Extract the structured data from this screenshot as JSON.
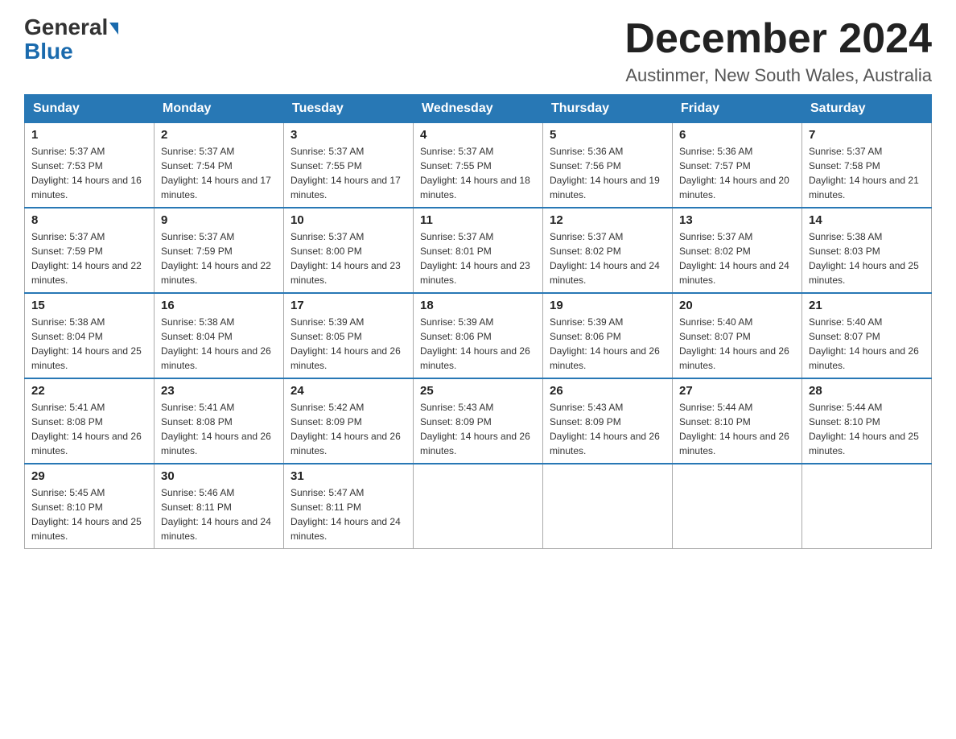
{
  "logo": {
    "general": "General",
    "blue": "Blue"
  },
  "title": {
    "month_year": "December 2024",
    "location": "Austinmer, New South Wales, Australia"
  },
  "headers": [
    "Sunday",
    "Monday",
    "Tuesday",
    "Wednesday",
    "Thursday",
    "Friday",
    "Saturday"
  ],
  "weeks": [
    [
      {
        "day": "1",
        "sunrise": "5:37 AM",
        "sunset": "7:53 PM",
        "daylight": "14 hours and 16 minutes."
      },
      {
        "day": "2",
        "sunrise": "5:37 AM",
        "sunset": "7:54 PM",
        "daylight": "14 hours and 17 minutes."
      },
      {
        "day": "3",
        "sunrise": "5:37 AM",
        "sunset": "7:55 PM",
        "daylight": "14 hours and 17 minutes."
      },
      {
        "day": "4",
        "sunrise": "5:37 AM",
        "sunset": "7:55 PM",
        "daylight": "14 hours and 18 minutes."
      },
      {
        "day": "5",
        "sunrise": "5:36 AM",
        "sunset": "7:56 PM",
        "daylight": "14 hours and 19 minutes."
      },
      {
        "day": "6",
        "sunrise": "5:36 AM",
        "sunset": "7:57 PM",
        "daylight": "14 hours and 20 minutes."
      },
      {
        "day": "7",
        "sunrise": "5:37 AM",
        "sunset": "7:58 PM",
        "daylight": "14 hours and 21 minutes."
      }
    ],
    [
      {
        "day": "8",
        "sunrise": "5:37 AM",
        "sunset": "7:59 PM",
        "daylight": "14 hours and 22 minutes."
      },
      {
        "day": "9",
        "sunrise": "5:37 AM",
        "sunset": "7:59 PM",
        "daylight": "14 hours and 22 minutes."
      },
      {
        "day": "10",
        "sunrise": "5:37 AM",
        "sunset": "8:00 PM",
        "daylight": "14 hours and 23 minutes."
      },
      {
        "day": "11",
        "sunrise": "5:37 AM",
        "sunset": "8:01 PM",
        "daylight": "14 hours and 23 minutes."
      },
      {
        "day": "12",
        "sunrise": "5:37 AM",
        "sunset": "8:02 PM",
        "daylight": "14 hours and 24 minutes."
      },
      {
        "day": "13",
        "sunrise": "5:37 AM",
        "sunset": "8:02 PM",
        "daylight": "14 hours and 24 minutes."
      },
      {
        "day": "14",
        "sunrise": "5:38 AM",
        "sunset": "8:03 PM",
        "daylight": "14 hours and 25 minutes."
      }
    ],
    [
      {
        "day": "15",
        "sunrise": "5:38 AM",
        "sunset": "8:04 PM",
        "daylight": "14 hours and 25 minutes."
      },
      {
        "day": "16",
        "sunrise": "5:38 AM",
        "sunset": "8:04 PM",
        "daylight": "14 hours and 26 minutes."
      },
      {
        "day": "17",
        "sunrise": "5:39 AM",
        "sunset": "8:05 PM",
        "daylight": "14 hours and 26 minutes."
      },
      {
        "day": "18",
        "sunrise": "5:39 AM",
        "sunset": "8:06 PM",
        "daylight": "14 hours and 26 minutes."
      },
      {
        "day": "19",
        "sunrise": "5:39 AM",
        "sunset": "8:06 PM",
        "daylight": "14 hours and 26 minutes."
      },
      {
        "day": "20",
        "sunrise": "5:40 AM",
        "sunset": "8:07 PM",
        "daylight": "14 hours and 26 minutes."
      },
      {
        "day": "21",
        "sunrise": "5:40 AM",
        "sunset": "8:07 PM",
        "daylight": "14 hours and 26 minutes."
      }
    ],
    [
      {
        "day": "22",
        "sunrise": "5:41 AM",
        "sunset": "8:08 PM",
        "daylight": "14 hours and 26 minutes."
      },
      {
        "day": "23",
        "sunrise": "5:41 AM",
        "sunset": "8:08 PM",
        "daylight": "14 hours and 26 minutes."
      },
      {
        "day": "24",
        "sunrise": "5:42 AM",
        "sunset": "8:09 PM",
        "daylight": "14 hours and 26 minutes."
      },
      {
        "day": "25",
        "sunrise": "5:43 AM",
        "sunset": "8:09 PM",
        "daylight": "14 hours and 26 minutes."
      },
      {
        "day": "26",
        "sunrise": "5:43 AM",
        "sunset": "8:09 PM",
        "daylight": "14 hours and 26 minutes."
      },
      {
        "day": "27",
        "sunrise": "5:44 AM",
        "sunset": "8:10 PM",
        "daylight": "14 hours and 26 minutes."
      },
      {
        "day": "28",
        "sunrise": "5:44 AM",
        "sunset": "8:10 PM",
        "daylight": "14 hours and 25 minutes."
      }
    ],
    [
      {
        "day": "29",
        "sunrise": "5:45 AM",
        "sunset": "8:10 PM",
        "daylight": "14 hours and 25 minutes."
      },
      {
        "day": "30",
        "sunrise": "5:46 AM",
        "sunset": "8:11 PM",
        "daylight": "14 hours and 24 minutes."
      },
      {
        "day": "31",
        "sunrise": "5:47 AM",
        "sunset": "8:11 PM",
        "daylight": "14 hours and 24 minutes."
      },
      null,
      null,
      null,
      null
    ]
  ]
}
